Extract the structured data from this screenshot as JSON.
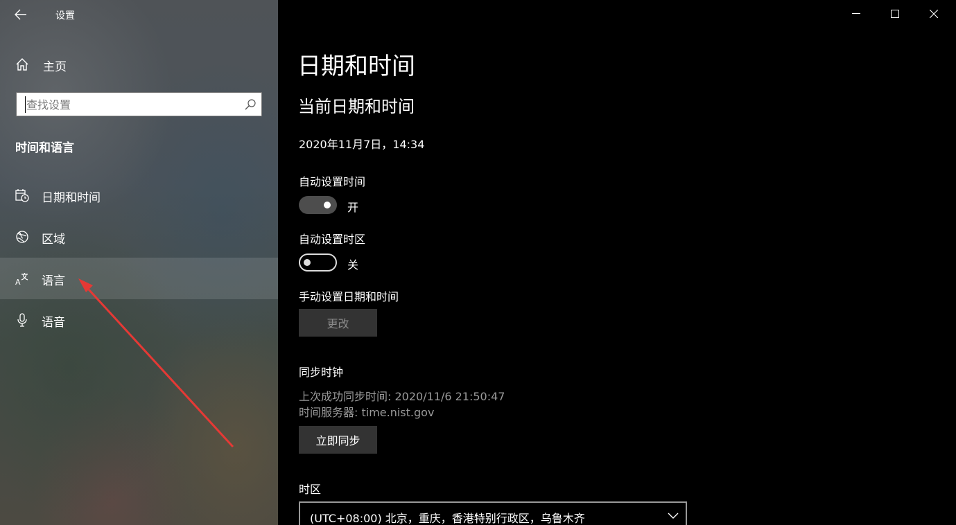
{
  "app": {
    "title": "设置"
  },
  "sidebar": {
    "home_label": "主页",
    "search_placeholder": "查找设置",
    "section_title": "时间和语言",
    "items": [
      {
        "label": "日期和时间",
        "icon": "calendar-clock-icon"
      },
      {
        "label": "区域",
        "icon": "globe-region-icon"
      },
      {
        "label": "语言",
        "icon": "language-icon",
        "selected": true
      },
      {
        "label": "语音",
        "icon": "microphone-icon"
      }
    ]
  },
  "content": {
    "page_title": "日期和时间",
    "current_section": "当前日期和时间",
    "current_datetime": "2020年11月7日，14:34",
    "auto_time": {
      "label": "自动设置时间",
      "state": "开",
      "on": true
    },
    "auto_timezone": {
      "label": "自动设置时区",
      "state": "关",
      "on": false
    },
    "manual": {
      "label": "手动设置日期和时间",
      "button": "更改"
    },
    "sync": {
      "label": "同步时钟",
      "last_sync": "上次成功同步时间: 2020/11/6 21:50:47",
      "server": "时间服务器: time.nist.gov",
      "button": "立即同步"
    },
    "timezone": {
      "label": "时区",
      "value": "(UTC+08:00) 北京，重庆，香港特别行政区，乌鲁木齐"
    }
  },
  "colors": {
    "annotation_arrow": "#e53935",
    "pane_bg": "#000000",
    "toggle_on": "#4d4d4d"
  }
}
